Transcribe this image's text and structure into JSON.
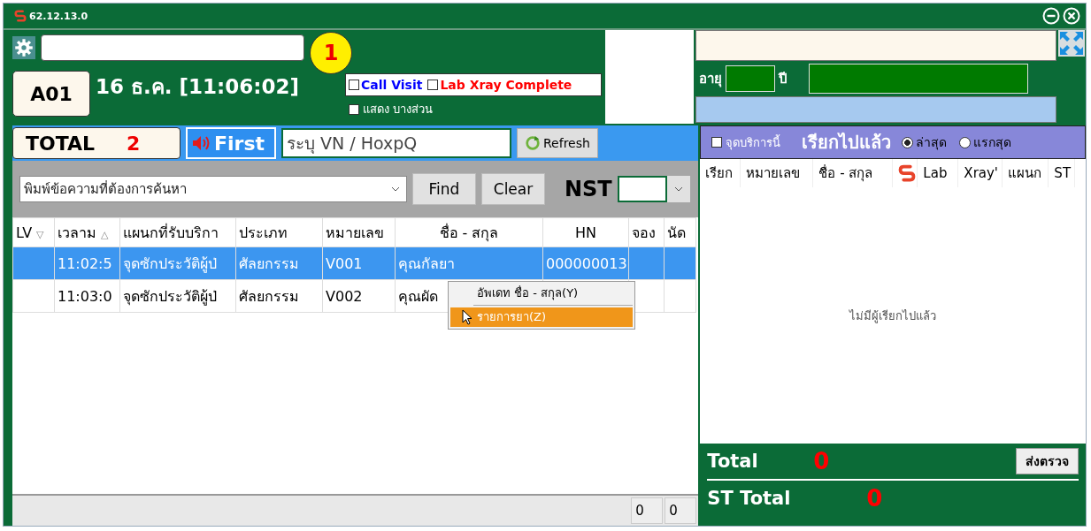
{
  "window": {
    "title": "62.12.13.0"
  },
  "header": {
    "badge": "1",
    "counter": "A01",
    "datetime": "16 ธ.ค. [11:06:02]",
    "options": [
      {
        "label": "Call Visit",
        "checked": false,
        "color": "#0000ff"
      },
      {
        "label": "Lab Xray Complete",
        "checked": false,
        "color": "#ff0000"
      }
    ],
    "partial_checkbox": {
      "label": "แสดง บางส่วน",
      "checked": false
    }
  },
  "patient": {
    "age_label": "อายุ",
    "year_label": "ปี"
  },
  "toolbar": {
    "total_label": "TOTAL",
    "total_count": "2",
    "first_button": "First",
    "vn_field": {
      "placeholder": "ระบุ VN / HoxpQ"
    },
    "refresh_button": "Refresh"
  },
  "search": {
    "placeholder": "พิมพ์ข้อความที่ต้องการค้นหา",
    "find_button": "Find",
    "clear_button": "Clear",
    "nst_label": "NST"
  },
  "table": {
    "columns": [
      {
        "label": "LV",
        "sort_icon": "▽"
      },
      {
        "label": "เวลาม",
        "sort_icon": "△"
      },
      {
        "label": "แผนกที่รับบริกา"
      },
      {
        "label": "ประเภท"
      },
      {
        "label": "หมายเลข"
      },
      {
        "label": "ชื่อ - สกุล"
      },
      {
        "label": "HN"
      },
      {
        "label": "จอง"
      },
      {
        "label": "นัด"
      }
    ],
    "rows": [
      {
        "selected": true,
        "cells": [
          "",
          "11:02:5",
          "จุดซักประวัติผู้ป่",
          "ศัลยกรรม",
          "V001",
          "คุณกัลยา",
          "000000013",
          "",
          ""
        ]
      },
      {
        "selected": false,
        "cells": [
          "",
          "11:03:0",
          "จุดซักประวัติผู้ป่",
          "ศัลยกรรม",
          "V002",
          "คุณผัด",
          "",
          "",
          ""
        ]
      }
    ]
  },
  "context_menu": {
    "items": [
      {
        "label": "อัพเดท ชื่อ - สกุล(Y)",
        "highlighted": false
      },
      {
        "label": "รายการยา(Z)",
        "highlighted": true
      }
    ]
  },
  "footer_counts": [
    "0",
    "0"
  ],
  "called_panel": {
    "this_point_checkbox": {
      "label": "จุดบริการนี้",
      "checked": false
    },
    "title": "เรียกไปแล้ว",
    "radios": [
      {
        "label": "ล่าสุด",
        "selected": true
      },
      {
        "label": "แรกสุด",
        "selected": false
      }
    ],
    "columns": [
      {
        "kind": "text",
        "label": "เรียก"
      },
      {
        "kind": "text",
        "label": "หมายเลข"
      },
      {
        "kind": "text",
        "label": "ชื่อ - สกุล"
      },
      {
        "kind": "icon"
      },
      {
        "kind": "text",
        "label": "Lab"
      },
      {
        "kind": "text",
        "label": "Xray'"
      },
      {
        "kind": "text",
        "label": "แผนก"
      },
      {
        "kind": "text",
        "label": "ST"
      }
    ],
    "empty_message": "ไม่มีผู้เรียกไปแล้ว",
    "total_label": "Total",
    "total_value": "0",
    "send_button": "ส่งตรวจ",
    "st_total_label": "ST Total",
    "st_total_value": "0"
  }
}
